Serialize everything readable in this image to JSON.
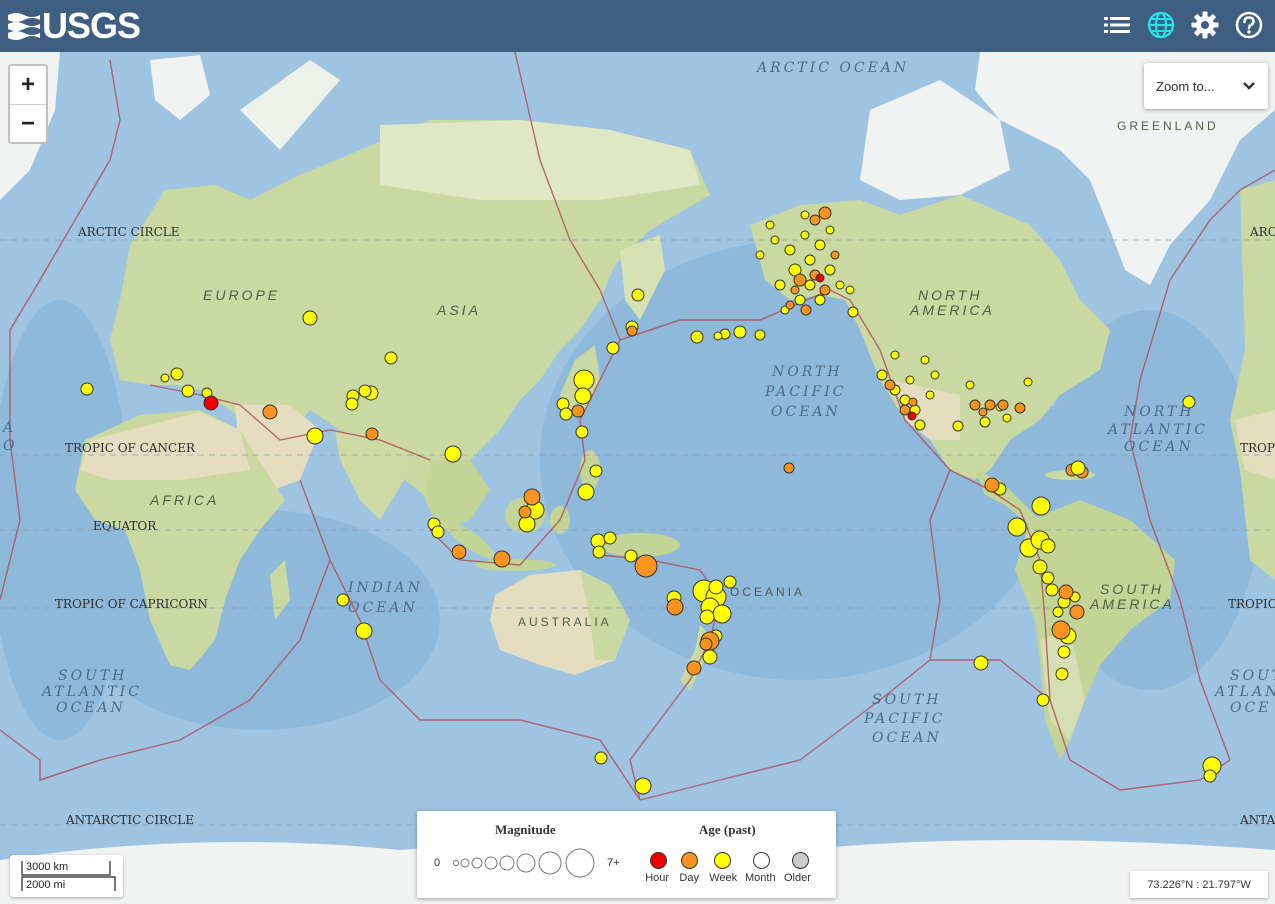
{
  "header": {
    "logo_text": "USGS",
    "icons": [
      "list-icon",
      "globe-icon",
      "gear-icon",
      "help-icon"
    ],
    "bg_color": "#3e5e82",
    "active_icon_color": "#28dfe8"
  },
  "map": {
    "zoom_in": "+",
    "zoom_out": "−",
    "zoom_to": "Zoom to...",
    "labels": {
      "arctic_ocean": "ARCTIC OCEAN",
      "greenland": "GREENLAND",
      "arctic_circle_left": "ARCTIC CIRCLE",
      "arctic_circle_right": "ARC",
      "europe": "EUROPE",
      "asia": "ASIA",
      "africa": "AFRICA",
      "north_america_1": "NORTH",
      "north_america_2": "AMERICA",
      "north_pacific_1": "NORTH",
      "north_pacific_2": "PACIFIC",
      "north_pacific_3": "OCEAN",
      "north_atlantic_1": "NORTH",
      "north_atlantic_2": "ATLANTIC",
      "north_atlantic_3": "OCEAN",
      "tropic_cancer_left": "TROPIC OF CANCER",
      "tropic_cancer_right": "TROPIC",
      "equator": "EQUATOR",
      "tropic_capricorn_left": "TROPIC OF CAPRICORN",
      "tropic_capricorn_right": "TROPIC",
      "indian_ocean_1": "INDIAN",
      "indian_ocean_2": "OCEAN",
      "australia": "AUSTRALIA",
      "oceania": "OCEANIA",
      "south_america_1": "SOUTH",
      "south_america_2": "AMERICA",
      "south_atlantic_left_1": "SOUTH",
      "south_atlantic_left_2": "ATLANTIC",
      "south_atlantic_left_3": "OCEAN",
      "south_atlantic_right_1": "SOUT",
      "south_atlantic_right_2": "ATLAN",
      "south_atlantic_right_3": "OCE",
      "south_pacific_1": "SOUTH",
      "south_pacific_2": "PACIFIC",
      "south_pacific_3": "OCEAN",
      "antarctic_circle_left": "ANTARCTIC CIRCLE",
      "antarctic_circle_right": "ANTAR",
      "left_edge_1": "A",
      "left_edge_2": "O"
    },
    "colors": {
      "ocean": "#9ec4e2",
      "land": "#c8d8a0",
      "land_desert": "#e3dcc0",
      "ice": "#f2f4f4",
      "plate_line": "#b4505a"
    }
  },
  "legend": {
    "magnitude_title": "Magnitude",
    "age_title": "Age (past)",
    "mag_min": "0",
    "mag_max": "7+",
    "ages": [
      {
        "label": "Hour",
        "color": "#ee0000"
      },
      {
        "label": "Day",
        "color": "#f7931e"
      },
      {
        "label": "Week",
        "color": "#ffff00"
      },
      {
        "label": "Month",
        "color": "#ffffff"
      },
      {
        "label": "Older",
        "color": "#cccccc"
      }
    ]
  },
  "scale": {
    "km": "3000 km",
    "mi": "2000 mi"
  },
  "coords": "73.226°N : 21.797°W"
}
